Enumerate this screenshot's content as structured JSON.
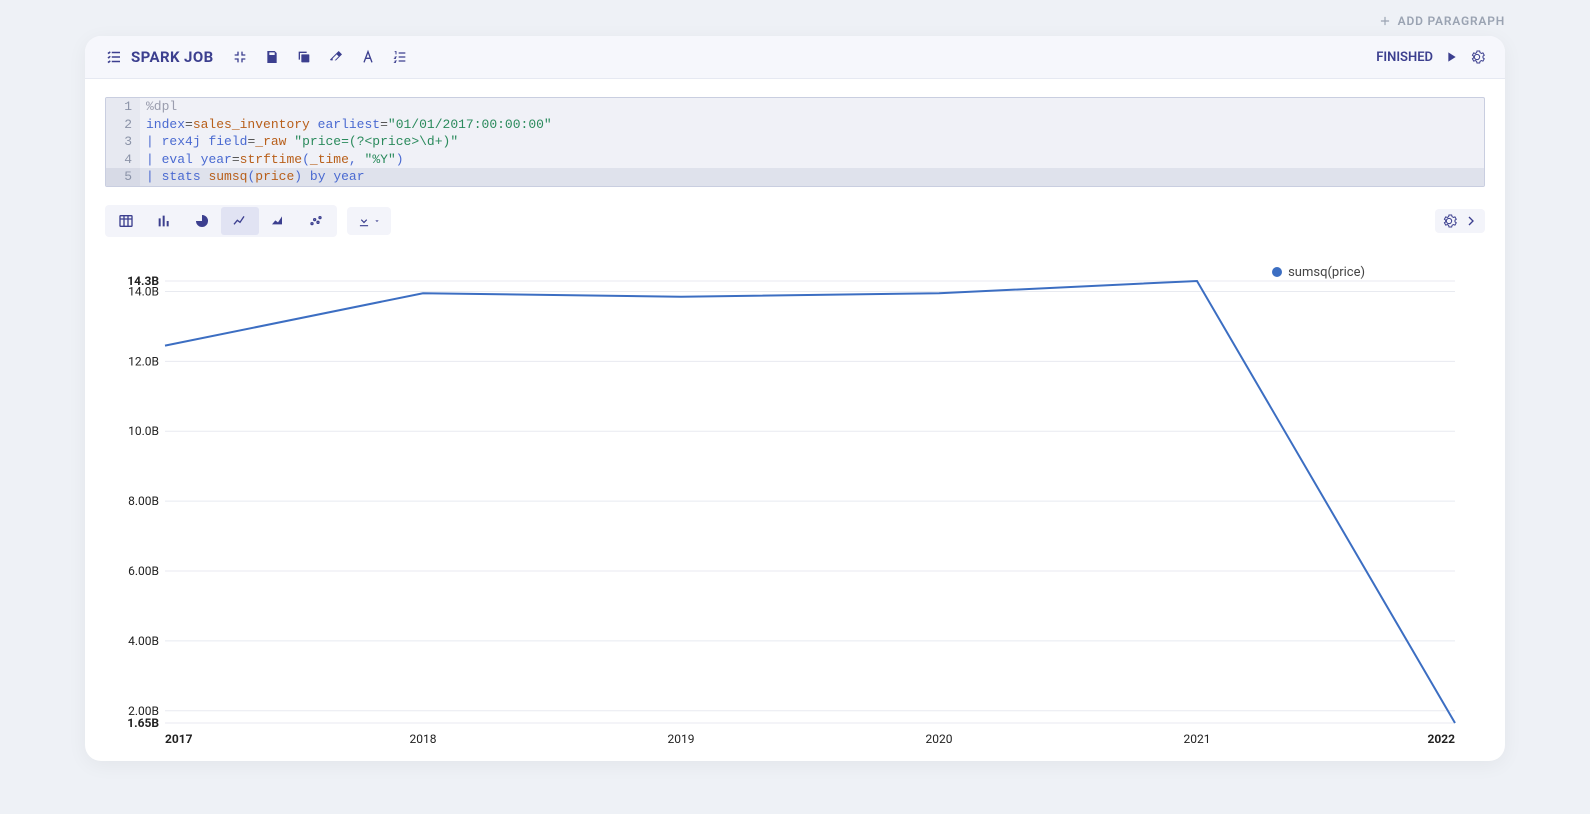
{
  "topbar": {
    "add_paragraph": "ADD PARAGRAPH"
  },
  "header": {
    "title": "SPARK JOB",
    "status": "FINISHED"
  },
  "code": {
    "lines": [
      {
        "n": 1,
        "tokens": [
          [
            "dir",
            "%dpl"
          ]
        ]
      },
      {
        "n": 2,
        "tokens": [
          [
            "kw",
            "index"
          ],
          [
            "op",
            "="
          ],
          [
            "fn",
            "sales_inventory"
          ],
          [
            "text",
            " "
          ],
          [
            "kw",
            "earliest"
          ],
          [
            "op",
            "="
          ],
          [
            "str",
            "\"01/01/2017:00:00:00\""
          ]
        ]
      },
      {
        "n": 3,
        "tokens": [
          [
            "punct",
            "| "
          ],
          [
            "kw",
            "rex4j"
          ],
          [
            "text",
            " "
          ],
          [
            "kw",
            "field"
          ],
          [
            "op",
            "="
          ],
          [
            "fn",
            "_raw"
          ],
          [
            "text",
            " "
          ],
          [
            "str",
            "\"price=(?<price>\\d+)\""
          ]
        ]
      },
      {
        "n": 4,
        "tokens": [
          [
            "punct",
            "| "
          ],
          [
            "kw",
            "eval"
          ],
          [
            "text",
            " "
          ],
          [
            "kw",
            "year"
          ],
          [
            "op",
            "="
          ],
          [
            "fn",
            "strftime"
          ],
          [
            "punct",
            "("
          ],
          [
            "fn",
            "_time"
          ],
          [
            "punct",
            ","
          ],
          [
            "text",
            " "
          ],
          [
            "str",
            "\"%Y\""
          ],
          [
            "punct",
            ")"
          ]
        ]
      },
      {
        "n": 5,
        "tokens": [
          [
            "punct",
            "| "
          ],
          [
            "kw",
            "stats"
          ],
          [
            "text",
            " "
          ],
          [
            "fn",
            "sumsq"
          ],
          [
            "punct",
            "("
          ],
          [
            "fn",
            "price"
          ],
          [
            "punct",
            ")"
          ],
          [
            "text",
            " "
          ],
          [
            "kw",
            "by"
          ],
          [
            "text",
            " "
          ],
          [
            "kw",
            "year"
          ]
        ]
      }
    ],
    "active_line": 5
  },
  "viz": {
    "buttons": [
      "table",
      "bar",
      "pie",
      "line",
      "area",
      "scatter"
    ],
    "active": "line"
  },
  "chart_data": {
    "type": "line",
    "legend": "sumsq(price)",
    "x": [
      "2017",
      "2018",
      "2019",
      "2020",
      "2021",
      "2022"
    ],
    "y": [
      12.45,
      13.95,
      13.85,
      13.95,
      14.3,
      1.65
    ],
    "ylim": [
      1.65,
      14.3
    ],
    "y_ticks": [
      14.3,
      14.0,
      12.0,
      10.0,
      8.0,
      6.0,
      4.0,
      2.0,
      1.65
    ],
    "y_tick_labels": [
      "14.3B",
      "14.0B",
      "12.0B",
      "10.0B",
      "8.00B",
      "6.00B",
      "4.00B",
      "2.00B",
      "1.65B"
    ],
    "x_tick_labels": [
      "2017",
      "2018",
      "2019",
      "2020",
      "2021",
      "2022"
    ]
  }
}
